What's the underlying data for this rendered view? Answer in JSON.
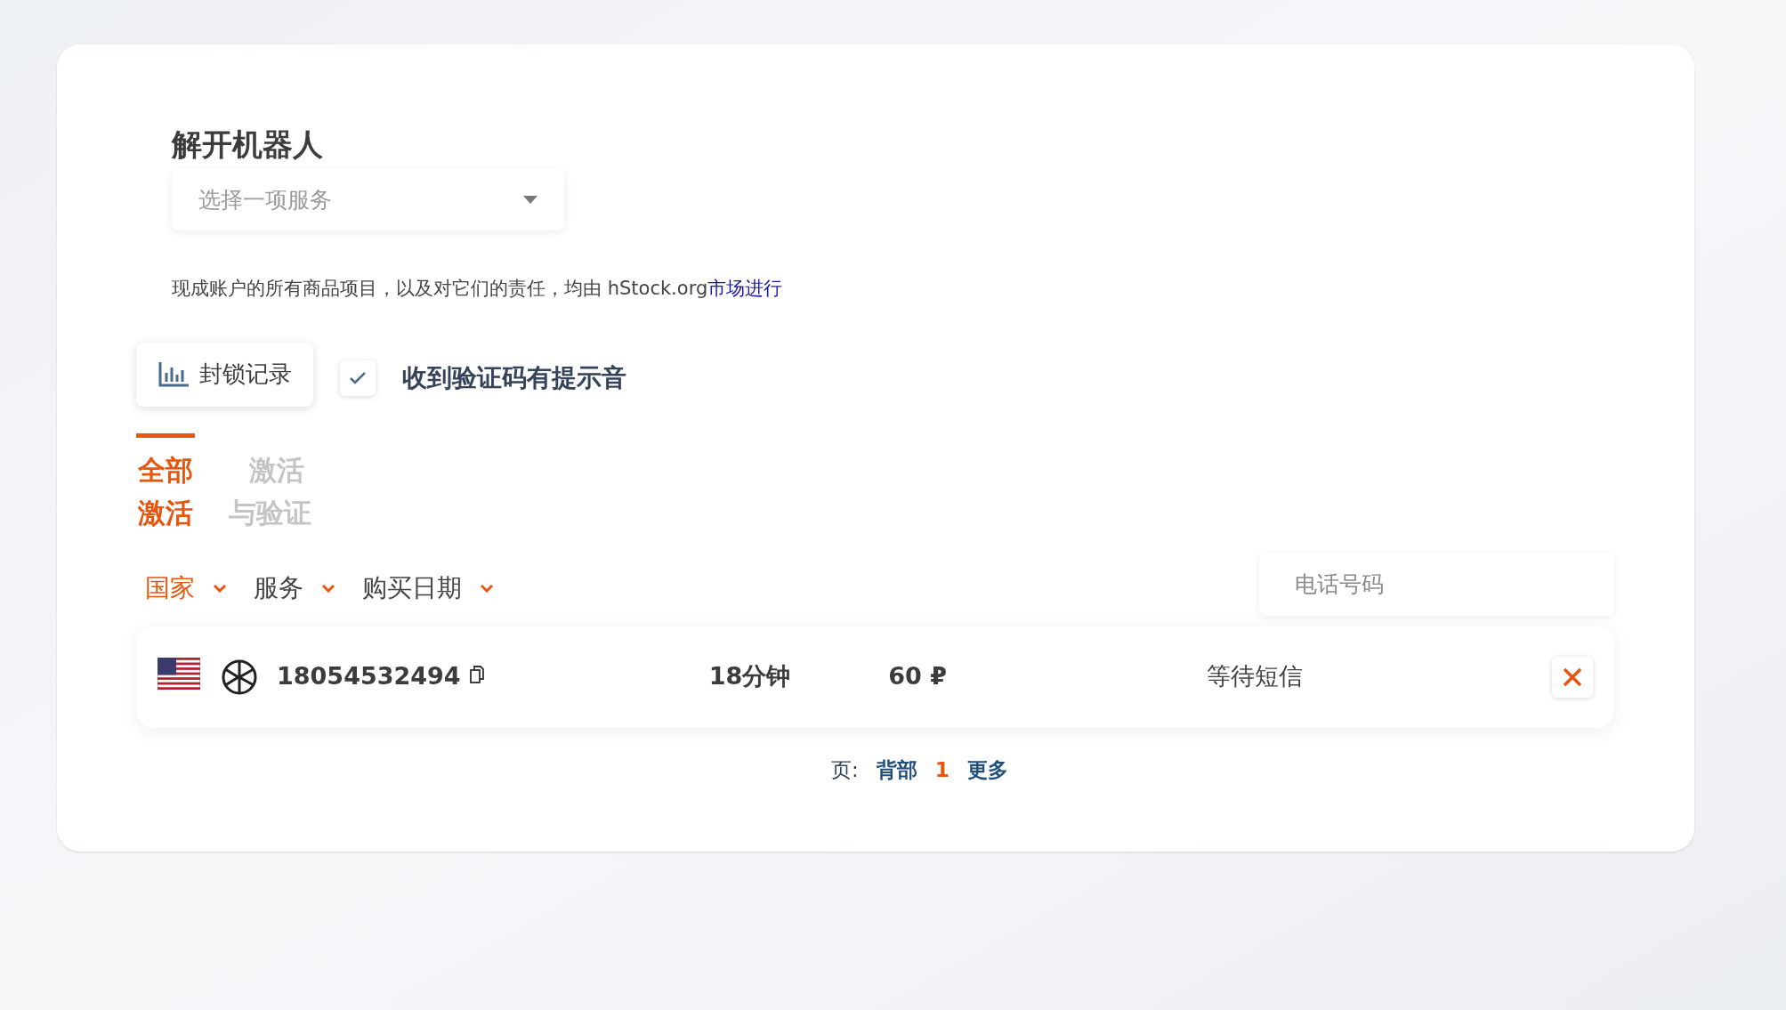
{
  "title": "解开机器人",
  "service_select": {
    "placeholder": "选择一项服务"
  },
  "notice": {
    "text": "现成账户的所有商品项目，以及对它们的责任，均由 hStock.org",
    "link": "市场进行"
  },
  "block_log_button": {
    "label": "封锁记录"
  },
  "sound_checkbox": {
    "label": "收到验证码有提示音",
    "checked": true
  },
  "tabs": [
    {
      "label": "全部激活",
      "selected": true
    },
    {
      "label": "激活与验证",
      "selected": false
    }
  ],
  "filters": [
    {
      "label": "国家",
      "active": true
    },
    {
      "label": "服务",
      "active": false
    },
    {
      "label": "购买日期",
      "active": false
    }
  ],
  "phone_search": {
    "placeholder": "电话号码"
  },
  "rows": [
    {
      "number": "18054532494",
      "duration": "18分钟",
      "price": "60 ₽",
      "status": "等待短信"
    }
  ],
  "pagination": {
    "label": "页:",
    "back": "背部",
    "current": "1",
    "more": "更多"
  }
}
